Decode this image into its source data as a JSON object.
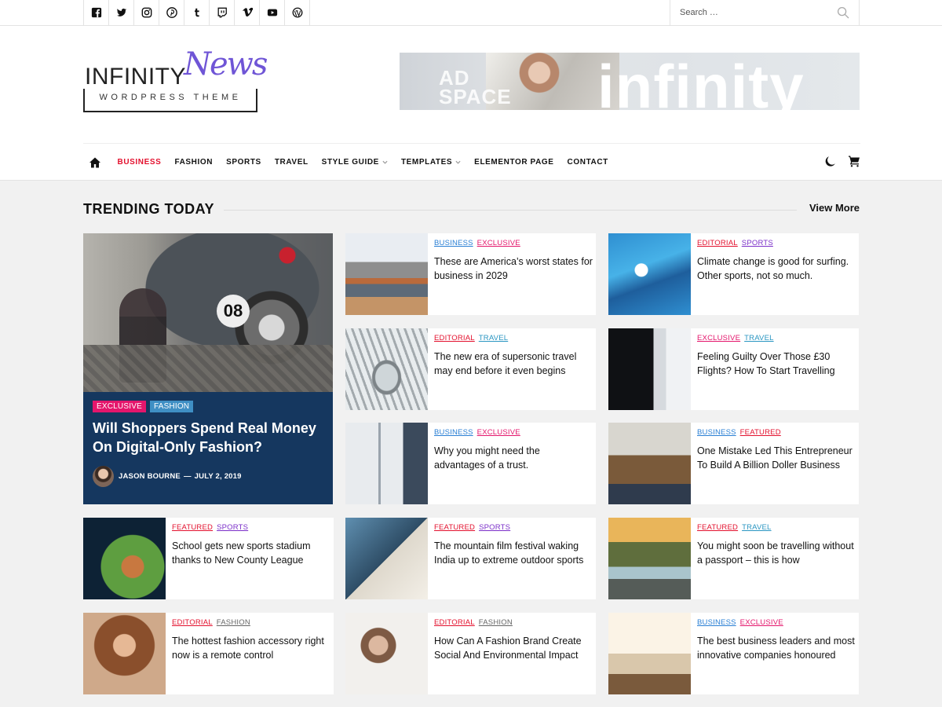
{
  "topbar": {
    "socials": [
      {
        "name": "facebook-icon",
        "label": "Facebook"
      },
      {
        "name": "twitter-icon",
        "label": "Twitter"
      },
      {
        "name": "instagram-icon",
        "label": "Instagram"
      },
      {
        "name": "pinterest-icon",
        "label": "Pinterest"
      },
      {
        "name": "tumblr-icon",
        "label": "Tumblr"
      },
      {
        "name": "twitch-icon",
        "label": "Twitch"
      },
      {
        "name": "vimeo-icon",
        "label": "Vimeo"
      },
      {
        "name": "youtube-icon",
        "label": "YouTube"
      },
      {
        "name": "wordpress-icon",
        "label": "WordPress"
      }
    ],
    "search_placeholder": "Search …"
  },
  "header": {
    "logo_infinity": "INFINITY",
    "logo_news": "News",
    "logo_sub": "WORDPRESS THEME",
    "ad_small": "AD SPACE",
    "ad_big": "infinity"
  },
  "nav": {
    "items": [
      {
        "label": "BUSINESS",
        "active": true,
        "caret": false
      },
      {
        "label": "FASHION",
        "active": false,
        "caret": false
      },
      {
        "label": "SPORTS",
        "active": false,
        "caret": false
      },
      {
        "label": "TRAVEL",
        "active": false,
        "caret": false
      },
      {
        "label": "STYLE GUIDE",
        "active": false,
        "caret": true
      },
      {
        "label": "TEMPLATES",
        "active": false,
        "caret": true
      },
      {
        "label": "ELEMENTOR PAGE",
        "active": false,
        "caret": false
      },
      {
        "label": "CONTACT",
        "active": false,
        "caret": false
      }
    ]
  },
  "trending": {
    "title": "TRENDING TODAY",
    "view_more": "View More",
    "feature": {
      "tags": [
        {
          "label": "EXCLUSIVE",
          "color": "#e4166c"
        },
        {
          "label": "FASHION",
          "color": "#3f8fc4"
        }
      ],
      "title": "Will Shoppers Spend Real Money On Digital-Only Fashion?",
      "author": "JASON BOURNE",
      "separator": "—",
      "date": "JULY 2, 2019"
    },
    "cards": [
      {
        "tags": [
          "BUSINESS",
          "EXCLUSIVE"
        ],
        "title": "These are America’s worst states for business in 2029"
      },
      {
        "tags": [
          "EDITORIAL",
          "SPORTS"
        ],
        "title": "Climate change is good for surfing. Other sports, not so much."
      },
      {
        "tags": [
          "EDITORIAL",
          "TRAVEL"
        ],
        "title": "The new era of supersonic travel may end before it even begins"
      },
      {
        "tags": [
          "EXCLUSIVE",
          "TRAVEL"
        ],
        "title": "Feeling Guilty Over Those £30 Flights? How To Start Travelling"
      },
      {
        "tags": [
          "BUSINESS",
          "EXCLUSIVE"
        ],
        "title": "Why you might need the advantages of a trust."
      },
      {
        "tags": [
          "BUSINESS",
          "FEATURED"
        ],
        "title": "One Mistake Led This Entrepreneur To Build A Billion Doller Business"
      },
      {
        "tags": [
          "FEATURED",
          "SPORTS"
        ],
        "title": "School gets new sports stadium thanks to New County League"
      },
      {
        "tags": [
          "FEATURED",
          "SPORTS"
        ],
        "title": "The mountain film festival waking India up to extreme outdoor sports"
      },
      {
        "tags": [
          "FEATURED",
          "TRAVEL"
        ],
        "title": "You might soon be travelling without a passport – this is how"
      },
      {
        "tags": [
          "EDITORIAL",
          "FASHION"
        ],
        "title": "The hottest fashion accessory right now is a remote control"
      },
      {
        "tags": [
          "EDITORIAL",
          "FASHION"
        ],
        "title": "How Can A Fashion Brand Create Social And Environmental Impact"
      },
      {
        "tags": [
          "BUSINESS",
          "EXCLUSIVE"
        ],
        "title": "The best business leaders and most innovative companies honoured"
      }
    ]
  },
  "colors": {
    "accent_red": "#e3112e",
    "logo_purple": "#6f55d6",
    "feature_bg": "#15375f",
    "tag_colors": {
      "BUSINESS": "#2a7fd4",
      "EXCLUSIVE": "#e4166c",
      "EDITORIAL": "#e3112e",
      "SPORTS": "#7b2fc9",
      "TRAVEL": "#2a96c2",
      "FEATURED": "#e3112e",
      "FASHION": "#666666"
    }
  }
}
